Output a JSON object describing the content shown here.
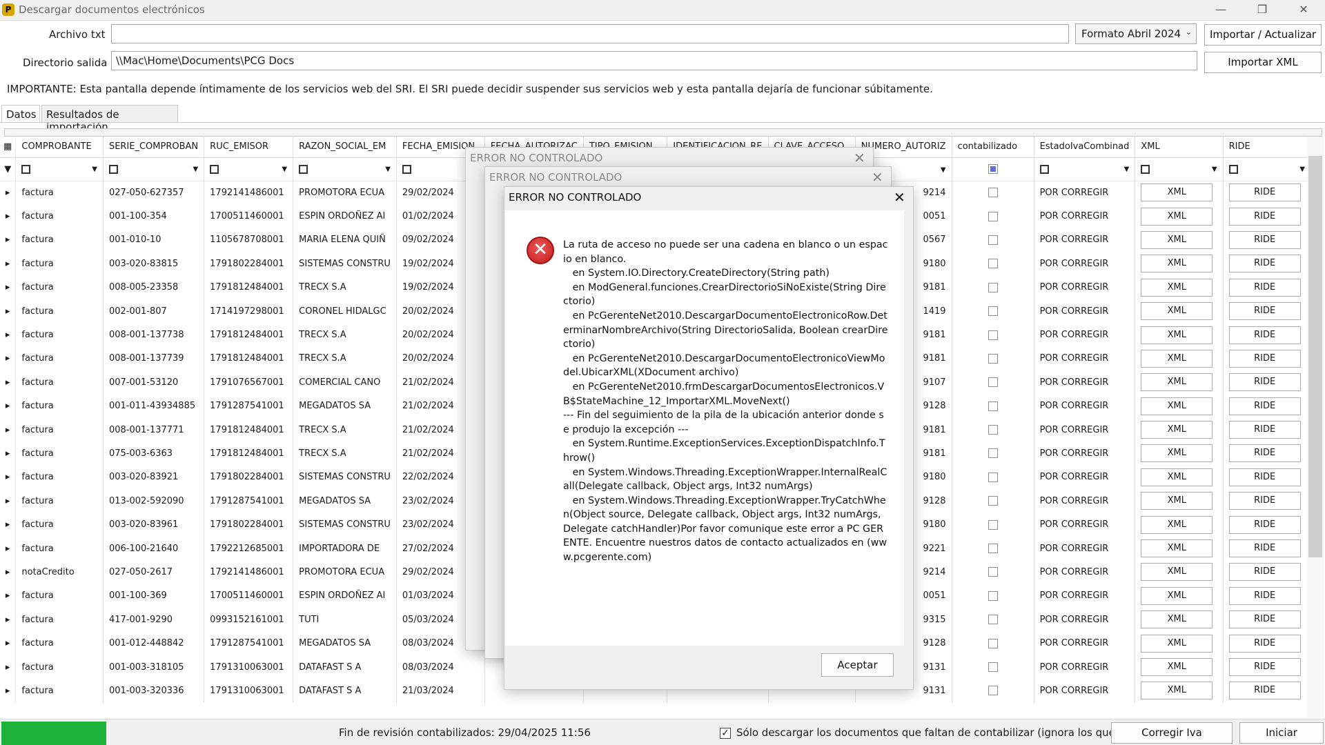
{
  "window": {
    "title": "Descargar documentos electrónicos"
  },
  "form": {
    "archivo_label": "Archivo txt",
    "archivo_value": "",
    "directorio_label": "Directorio salida",
    "directorio_value": "\\\\Mac\\Home\\Documents\\PCG Docs",
    "formato_value": "Formato Abril 2024",
    "importar_actualizar_label": "Importar / Actualizar",
    "importar_xml_label": "Importar XML"
  },
  "notice": "IMPORTANTE: Esta pantalla depende íntimamente de los servicios web del SRI. El SRI puede decidir suspender sus servicios web y esta pantalla dejaría de funcionar súbitamente.",
  "tabs": [
    "Datos",
    "Resultados de importación"
  ],
  "columns": [
    "COMPROBANTE",
    "SERIE_COMPROBAN",
    "RUC_EMISOR",
    "RAZON_SOCIAL_EM",
    "FECHA_EMISION",
    "FECHA_AUTORIZAC",
    "TIPO_EMISION",
    "IDENTIFICACION_RE",
    "CLAVE_ACCESO",
    "NUMERO_AUTORIZ",
    "contabilizado",
    "EstadoIvaCombinad",
    "XML",
    "RIDE"
  ],
  "rows": [
    [
      "factura",
      "027-050-627357",
      "1792141486001",
      "PROMOTORA ECUA",
      "29/02/2024",
      "9214"
    ],
    [
      "factura",
      "001-100-354",
      "1700511460001",
      "ESPIN ORDOÑEZ AI",
      "01/02/2024",
      "0051"
    ],
    [
      "factura",
      "001-010-10",
      "1105678708001",
      "MARIA ELENA QUIÑ",
      "09/02/2024",
      "0567"
    ],
    [
      "factura",
      "003-020-83815",
      "1791802284001",
      "SISTEMAS CONSTRU",
      "19/02/2024",
      "9180"
    ],
    [
      "factura",
      "008-005-23358",
      "1791812484001",
      "TRECX S.A",
      "19/02/2024",
      "9181"
    ],
    [
      "factura",
      "002-001-807",
      "1714197298001",
      "CORONEL HIDALGC",
      "20/02/2024",
      "1419"
    ],
    [
      "factura",
      "008-001-137738",
      "1791812484001",
      "TRECX S.A",
      "20/02/2024",
      "9181"
    ],
    [
      "factura",
      "008-001-137739",
      "1791812484001",
      "TRECX S.A",
      "20/02/2024",
      "9181"
    ],
    [
      "factura",
      "007-001-53120",
      "1791076567001",
      "COMERCIAL CANO",
      "21/02/2024",
      "9107"
    ],
    [
      "factura",
      "001-011-43934885",
      "1791287541001",
      "MEGADATOS SA",
      "21/02/2024",
      "9128"
    ],
    [
      "factura",
      "008-001-137771",
      "1791812484001",
      "TRECX S.A",
      "21/02/2024",
      "9181"
    ],
    [
      "factura",
      "075-003-6363",
      "1791812484001",
      "TRECX S.A",
      "21/02/2024",
      "9181"
    ],
    [
      "factura",
      "003-020-83921",
      "1791802284001",
      "SISTEMAS CONSTRU",
      "22/02/2024",
      "9180"
    ],
    [
      "factura",
      "013-002-592090",
      "1791287541001",
      "MEGADATOS SA",
      "23/02/2024",
      "9128"
    ],
    [
      "factura",
      "003-020-83961",
      "1791802284001",
      "SISTEMAS CONSTRU",
      "23/02/2024",
      "9180"
    ],
    [
      "factura",
      "006-100-21640",
      "1792212685001",
      "IMPORTADORA DE",
      "27/02/2024",
      "9221"
    ],
    [
      "notaCredito",
      "027-050-2617",
      "1792141486001",
      "PROMOTORA ECUA",
      "29/02/2024",
      "9214"
    ],
    [
      "factura",
      "001-100-369",
      "1700511460001",
      "ESPIN ORDOÑEZ AI",
      "01/03/2024",
      "0051"
    ],
    [
      "factura",
      "417-001-9290",
      "0993152161001",
      "TUTI",
      "05/03/2024",
      "9315"
    ],
    [
      "factura",
      "001-012-448842",
      "1791287541001",
      "MEGADATOS SA",
      "08/03/2024",
      "9128"
    ],
    [
      "factura",
      "001-003-318105",
      "1791310063001",
      "DATAFAST S A",
      "08/03/2024",
      "9131"
    ],
    [
      "factura",
      "001-003-320336",
      "1791310063001",
      "DATAFAST S A",
      "21/03/2024",
      "9131"
    ]
  ],
  "row_estado": "POR CORREGIR",
  "row_xml": "XML",
  "row_ride": "RIDE",
  "dialog": {
    "title": "ERROR NO CONTROLADO",
    "message": "La ruta de acceso no puede ser una cadena en blanco o un espacio en blanco.\n   en System.IO.Directory.CreateDirectory(String path)\n   en ModGeneral.funciones.CrearDirectorioSiNoExiste(String Directorio)\n   en PcGerenteNet2010.DescargarDocumentoElectronicoRow.DeterminarNombreArchivo(String DirectorioSalida, Boolean crearDirectorio)\n   en PcGerenteNet2010.DescargarDocumentoElectronicoViewModel.UbicarXML(XDocument archivo)\n   en PcGerenteNet2010.frmDescargarDocumentosElectronicos.VB$StateMachine_12_ImportarXML.MoveNext()\n--- Fin del seguimiento de la pila de la ubicación anterior donde se produjo la excepción ---\n   en System.Runtime.ExceptionServices.ExceptionDispatchInfo.Throw()\n   en System.Windows.Threading.ExceptionWrapper.InternalRealCall(Delegate callback, Object args, Int32 numArgs)\n   en System.Windows.Threading.ExceptionWrapper.TryCatchWhen(Object source, Delegate callback, Object args, Int32 numArgs, Delegate catchHandler)Por favor comunique este error a PC GERENTE. Encuentre nuestros datos de contacto actualizados en (www.pcgerente.com)",
    "ok_label": "Aceptar"
  },
  "status": {
    "progress": 1.0,
    "text": "Fin de revisión contabilizados: 29/04/2025 11:56",
    "checkbox_label": "Sólo descargar los documentos que faltan de contabilizar (ignora los que ya",
    "corregir_label": "Corregir Iva Combinado",
    "iniciar_label": "Iniciar Descarga"
  },
  "colors": {
    "progress": "#1db33a",
    "error": "#c21818"
  }
}
